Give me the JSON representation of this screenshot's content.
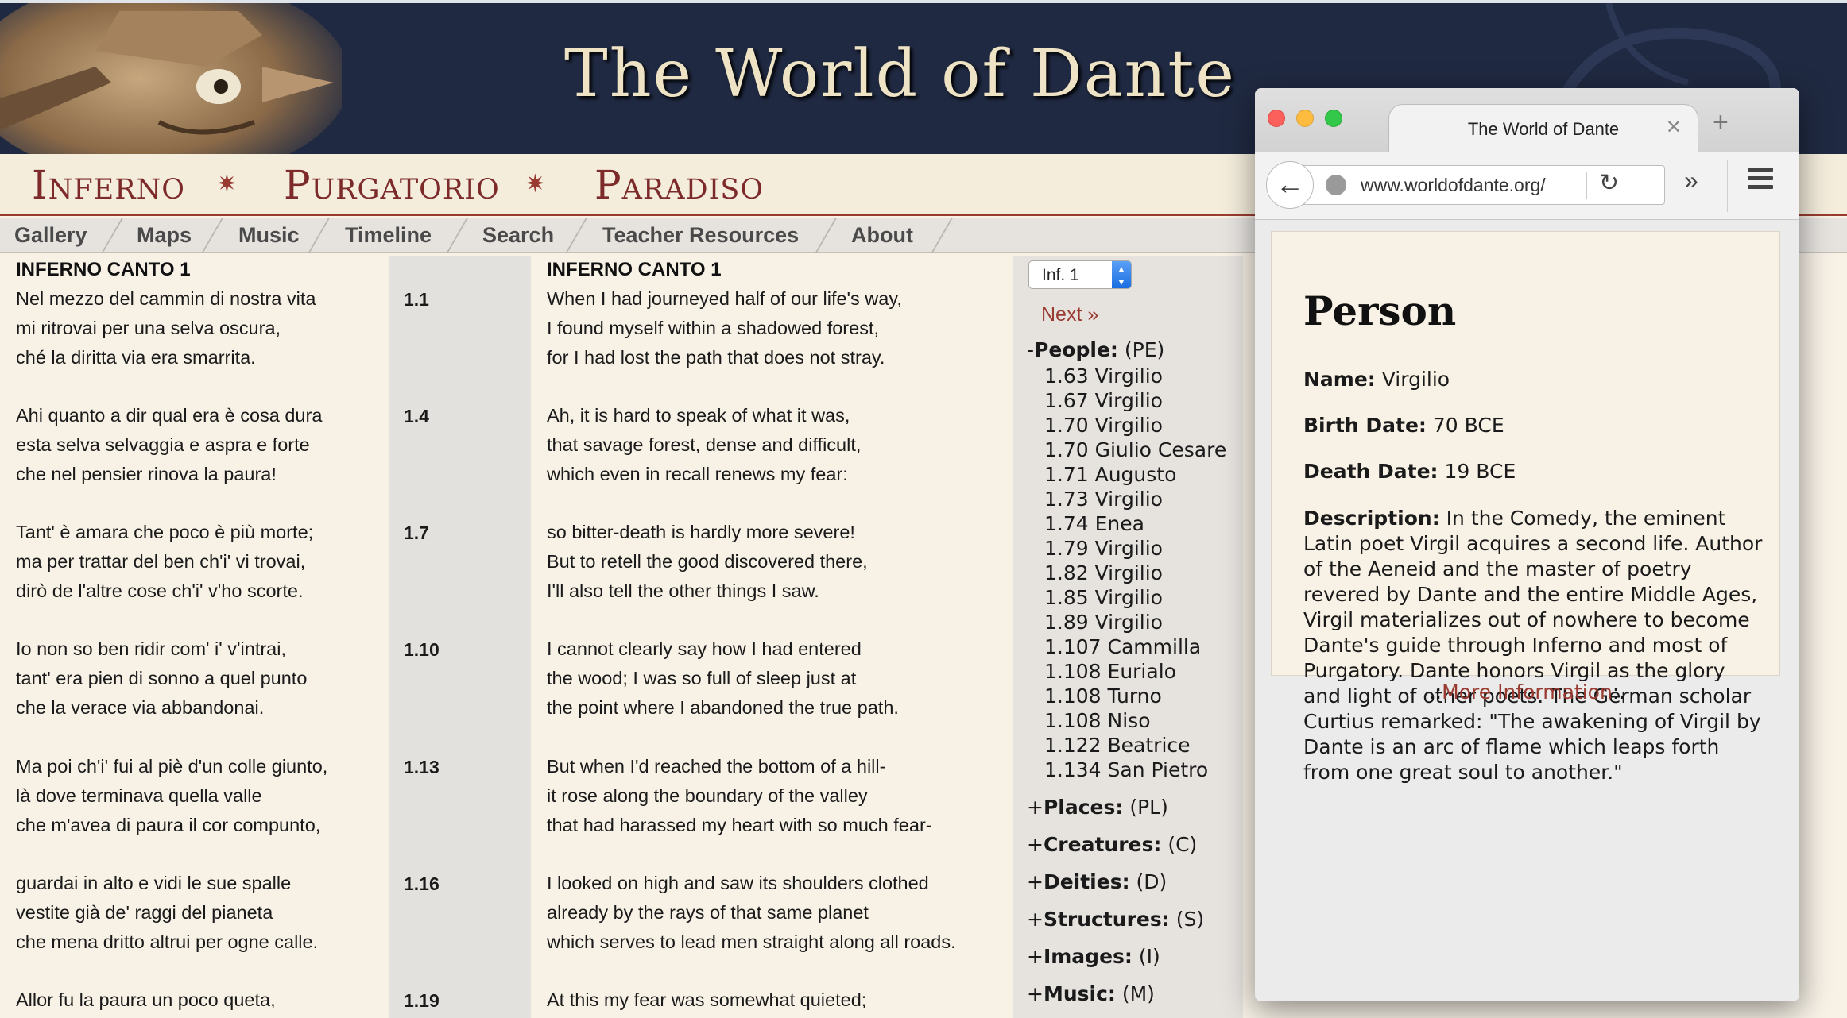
{
  "site": {
    "title": "The World of Dante",
    "cantiche": [
      "Inferno",
      "Purgatorio",
      "Paradiso"
    ],
    "nav": [
      "Gallery",
      "Maps",
      "Music",
      "Timeline",
      "Search",
      "Teacher Resources",
      "About"
    ]
  },
  "text": {
    "italian_title": "INFERNO CANTO 1",
    "english_title": "INFERNO CANTO 1",
    "tercets": [
      {
        "num": "1.1",
        "it": [
          "Nel mezzo del cammin di nostra vita",
          "mi ritrovai per una selva oscura,",
          "ché la diritta via era smarrita."
        ],
        "en": [
          "When I had journeyed half of our life's way,",
          "I found myself within a shadowed forest,",
          "for I had lost the path that does not stray."
        ]
      },
      {
        "num": "1.4",
        "it": [
          "Ahi quanto a dir qual era è cosa dura",
          "esta selva selvaggia e aspra e forte",
          "che nel pensier rinova la paura!"
        ],
        "en": [
          "Ah, it is hard to speak of what it was,",
          "that savage forest, dense and difficult,",
          "which even in recall renews my fear:"
        ]
      },
      {
        "num": "1.7",
        "it": [
          "Tant' è amara che poco è più morte;",
          "ma per trattar del ben ch'i' vi trovai,",
          "dirò de l'altre cose ch'i' v'ho scorte."
        ],
        "en": [
          "so bitter-death is hardly more severe!",
          "But to retell the good discovered there,",
          "I'll also tell the other things I saw."
        ]
      },
      {
        "num": "1.10",
        "it": [
          "Io non so ben ridir com' i' v'intrai,",
          "tant' era pien di sonno a quel punto",
          "che la verace via abbandonai."
        ],
        "en": [
          "I cannot clearly say how I had entered",
          "the wood; I was so full of sleep just at",
          "the point where I abandoned the true path."
        ]
      },
      {
        "num": "1.13",
        "it": [
          "Ma poi ch'i' fui al piè d'un colle giunto,",
          "là dove terminava quella valle",
          "che m'avea di paura il cor compunto,"
        ],
        "en": [
          "But when I'd reached the bottom of a hill-",
          "it rose along the boundary of the valley",
          "that had harassed my heart with so much fear-"
        ]
      },
      {
        "num": "1.16",
        "it": [
          "guardai in alto e vidi le sue spalle",
          "vestite già de' raggi del pianeta",
          "che mena dritto altrui per ogne calle."
        ],
        "en": [
          "I looked on high and saw its shoulders clothed",
          "already by the rays of that same planet",
          "which serves to lead men straight along all roads."
        ]
      },
      {
        "num": "1.19",
        "it": [
          "Allor fu la paura un poco queta,"
        ],
        "en": [
          "At this my fear was somewhat quieted;"
        ]
      }
    ]
  },
  "sidebar": {
    "select_value": "Inf. 1",
    "next_label": "Next »",
    "people": {
      "toggle": "-",
      "label": "People:",
      "abbr": "(PE)",
      "items": [
        "1.63 Virgilio",
        "1.67 Virgilio",
        "1.70 Virgilio",
        "1.70 Giulio Cesare",
        "1.71 Augusto",
        "1.73 Virgilio",
        "1.74 Enea",
        "1.79 Virgilio",
        "1.82 Virgilio",
        "1.85 Virgilio",
        "1.89 Virgilio",
        "1.107 Cammilla",
        "1.108 Eurialo",
        "1.108 Turno",
        "1.108 Niso",
        "1.122 Beatrice",
        "1.134 San Pietro"
      ]
    },
    "categories": [
      {
        "toggle": "+",
        "label": "Places:",
        "abbr": "(PL)"
      },
      {
        "toggle": "+",
        "label": "Creatures:",
        "abbr": "(C)"
      },
      {
        "toggle": "+",
        "label": "Deities:",
        "abbr": "(D)"
      },
      {
        "toggle": "+",
        "label": "Structures:",
        "abbr": "(S)"
      },
      {
        "toggle": "+",
        "label": "Images:",
        "abbr": "(I)"
      },
      {
        "toggle": "+",
        "label": "Music:",
        "abbr": "(M)"
      }
    ]
  },
  "popup": {
    "tab_title": "The World of Dante",
    "url": "www.worldofdante.org/",
    "heading": "Person",
    "name_label": "Name:",
    "name_value": "Virgilio",
    "birth_label": "Birth Date:",
    "birth_value": "70 BCE",
    "death_label": "Death Date:",
    "death_value": "19 BCE",
    "desc_label": "Description:",
    "desc_value": "In the Comedy, the eminent Latin poet Virgil acquires a second life. Author of the Aeneid and the master of poetry revered by Dante and the entire Middle Ages, Virgil materializes out of nowhere to become Dante's guide through Inferno and most of Purgatory. Dante honors Virgil as the glory and light of other poets. The German scholar Curtius remarked: \"The awakening of Virgil by Dante is an arc of flame which leaps forth from one great soul to another.\"",
    "more_prefix": ".:",
    "more_link": "More Information",
    "more_suffix": ":."
  },
  "colors": {
    "banner": "#1f2941",
    "accent": "#9a3b32",
    "parchment": "#f7f1e6"
  },
  "icons": [
    "back-arrow-icon",
    "globe-icon",
    "reload-icon",
    "overflow-chevrons-icon",
    "hamburger-menu-icon",
    "tab-close-icon",
    "new-tab-icon",
    "select-arrows-icon"
  ]
}
